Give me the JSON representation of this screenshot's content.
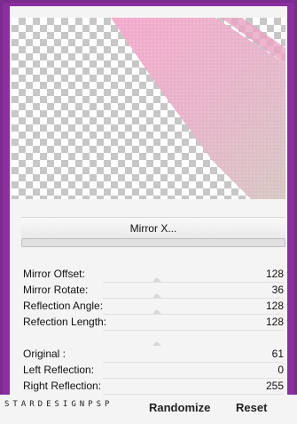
{
  "mirror_button": {
    "label": "Mirror X..."
  },
  "params": [
    {
      "label": "Mirror Offset:",
      "value": "128"
    },
    {
      "label": "Mirror Rotate:",
      "value": "36"
    },
    {
      "label": "Reflection Angle:",
      "value": "128"
    },
    {
      "label": "Refection Length:",
      "value": "128"
    }
  ],
  "reflection": [
    {
      "label": "Original :",
      "value": "61"
    },
    {
      "label": "Left Reflection:",
      "value": "0"
    },
    {
      "label": "Right Reflection:",
      "value": "255"
    }
  ],
  "footer": {
    "brand": "STARDESIGNPSP",
    "randomize_label": "Randomize",
    "reset_label": "Reset"
  },
  "colors": {
    "frame": "#8a2f9e",
    "pink_gradient_start": "#f2a6c8",
    "pink_gradient_end": "#d8c5c1"
  }
}
